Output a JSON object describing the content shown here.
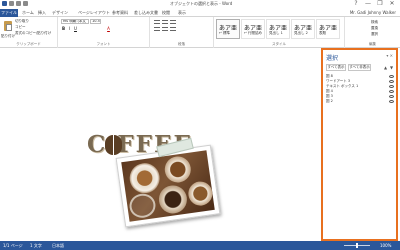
{
  "window": {
    "title": "オブジェクトの選択と表示 - Word",
    "controls": [
      "?",
      "—",
      "❐",
      "✕"
    ]
  },
  "ribbon_tabs": {
    "file": "ファイル",
    "items": [
      "ホーム",
      "挿入",
      "デザイン",
      "ページレイアウト",
      "参考資料",
      "差し込み文書",
      "校閲",
      "表示"
    ],
    "user": "Mr. Gadi Johnny Walker"
  },
  "clipboard": {
    "paste": "貼り付け",
    "cut": "切り取り",
    "copy": "コピー",
    "format_painter": "書式のコピー/貼り付け",
    "group_label": "クリップボード"
  },
  "font": {
    "name": "MS 明朝 (本文",
    "size": "10.5",
    "bold": "B",
    "italic": "I",
    "underline": "U",
    "font_color": "A",
    "group_label": "フォント"
  },
  "paragraph": {
    "group_label": "段落"
  },
  "styles": {
    "items": [
      {
        "sample": "あア亜",
        "name": "↵ 標準"
      },
      {
        "sample": "あア亜",
        "name": "↵ 行間詰め"
      },
      {
        "sample": "あア亜",
        "name": "見出し 1"
      },
      {
        "sample": "あア亜",
        "name": "見出し 2"
      },
      {
        "sample": "あア亜",
        "name": "表題"
      }
    ],
    "group_label": "スタイル"
  },
  "editing": {
    "find": "検索",
    "replace": "置換",
    "select": "選択",
    "group_label": "編集"
  },
  "document": {
    "heading_text": "C  FFEE"
  },
  "selection_pane": {
    "title": "選択",
    "controls": "▾ ✕",
    "show_all": "すべて表示",
    "hide_all": "すべて非表示",
    "sort_up": "▲",
    "sort_down": "▼",
    "objects": [
      "図 8",
      "ワードアート 3",
      "テキスト ボックス 1",
      "図 4",
      "図 3",
      "図 2"
    ]
  },
  "statusbar": {
    "page": "1/1 ページ",
    "words": "1 文字",
    "language": "日本語",
    "zoom": "100%"
  }
}
